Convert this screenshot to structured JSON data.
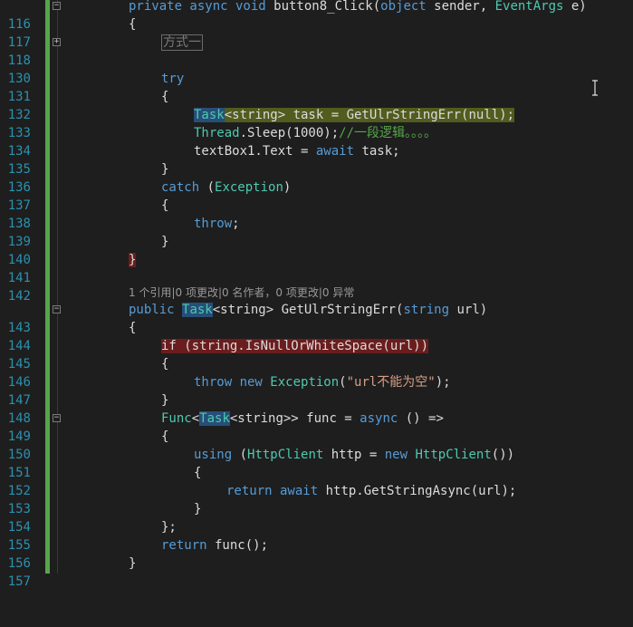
{
  "editor": {
    "language": "C#",
    "colors": {
      "background": "#1e1e1e",
      "line_number": "#2b91af",
      "keyword": "#569cd6",
      "type": "#4ec9b0",
      "text": "#dcdcdc",
      "comment": "#57a64a",
      "string": "#d69d85",
      "change_margin": "#57a64a"
    },
    "line_numbers": [
      "116",
      "117",
      "118",
      "130",
      "131",
      "132",
      "133",
      "134",
      "135",
      "136",
      "137",
      "138",
      "139",
      "140",
      "141",
      "142",
      "143",
      "144",
      "145",
      "146",
      "147",
      "148",
      "149",
      "150",
      "151",
      "152",
      "153",
      "154",
      "155",
      "156",
      "157"
    ],
    "code": {
      "l116": {
        "kw1": "private async void",
        "name": " button8_Click(",
        "kw2": "object",
        "mid": " sender, ",
        "ty": "EventArgs",
        "end": " e)"
      },
      "l117": "{",
      "l118": "方式一",
      "l131": "try",
      "l132": "{",
      "l133": {
        "ty1": "Task",
        "rest": "<string> task = GetUlrStringErr(null);"
      },
      "l134": {
        "ty": "Thread",
        "rest": ".Sleep(1000);",
        "cm": "//一段逻辑。。。。"
      },
      "l135": {
        "a": "textBox1.Text = ",
        "kw": "await",
        "b": " task;"
      },
      "l136": "}",
      "l137": {
        "kw": "catch",
        "a": " (",
        "ty": "Exception",
        "b": ")"
      },
      "l138": "{",
      "l139": {
        "kw": "throw",
        "b": ";"
      },
      "l140": "}",
      "l141": "}",
      "codelens": "1 个引用|0 项更改|0 名作者，0 项更改|0 异常",
      "l143": {
        "kw1": "public",
        "ty": "Task",
        "a": "<string> GetUlrStringErr(",
        "kw2": "string",
        "b": " url)"
      },
      "l144": "{",
      "l145": "if (string.IsNullOrWhiteSpace(url))",
      "l146": "{",
      "l147": {
        "kw": "throw new",
        "ty": "Exception",
        "a": "(",
        "st": "\"url不能为空\"",
        "b": ");"
      },
      "l148": "}",
      "l149": {
        "ty1": "Func",
        "a": "<",
        "ty2": "Task",
        "b": "<string>> func = ",
        "kw": "async",
        "c": " () =>"
      },
      "l150": "{",
      "l151": {
        "kw1": "using",
        "a": " (",
        "ty1": "HttpClient",
        "b": " http = ",
        "kw2": "new",
        "ty2": "HttpClient",
        "c": "())"
      },
      "l152": "{",
      "l153": {
        "kw": "return await",
        "a": " http.GetStringAsync(url);"
      },
      "l154": "}",
      "l155": "};",
      "l156": {
        "kw": "return",
        "a": " func();"
      },
      "l157": "}"
    }
  }
}
